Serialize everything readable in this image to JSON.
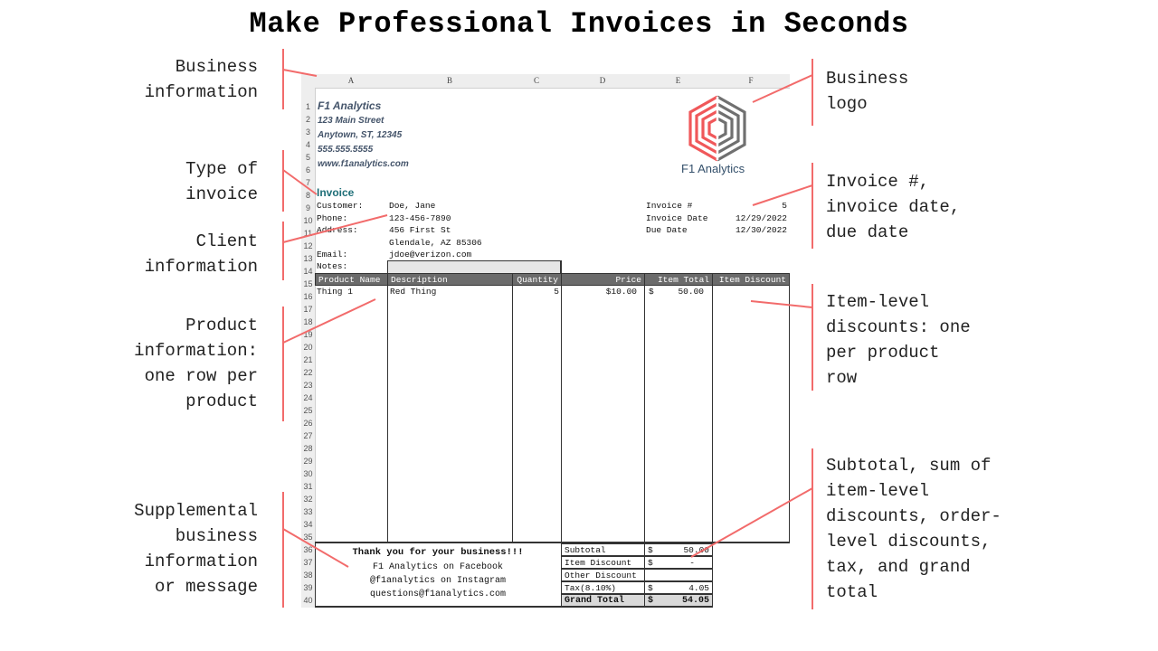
{
  "title": "Make Professional Invoices in Seconds",
  "annotations": {
    "business_info": "Business\ninformation",
    "invoice_type": "Type of\ninvoice",
    "client_info": "Client\ninformation",
    "product_info": "Product\ninformation:\none row per\nproduct",
    "supplemental": "Supplemental\nbusiness\ninformation\nor message",
    "business_logo": "Business\nlogo",
    "invoice_meta": "Invoice #,\ninvoice date,\ndue date",
    "item_discounts": "Item-level\ndiscounts: one\nper product\nrow",
    "totals": "Subtotal, sum of\nitem-level\ndiscounts, order-\nlevel discounts,\ntax, and grand\ntotal"
  },
  "colors": {
    "annotation_line": "#f26b6b",
    "header_fill": "#6b6b6b",
    "business_text": "#44546a",
    "invoice_title": "#1f6f78",
    "logo_red": "#f0585a",
    "logo_gray": "#707070"
  },
  "sheet": {
    "columns": [
      "A",
      "B",
      "C",
      "D",
      "E",
      "F"
    ],
    "row_numbers": [
      "1",
      "2",
      "3",
      "4",
      "5",
      "6",
      "7",
      "8",
      "9",
      "10",
      "11",
      "12",
      "13",
      "14",
      "15",
      "16",
      "17",
      "18",
      "19",
      "20",
      "21",
      "22",
      "23",
      "24",
      "25",
      "26",
      "27",
      "28",
      "29",
      "30",
      "31",
      "32",
      "33",
      "34",
      "35",
      "36",
      "37",
      "38",
      "39",
      "40"
    ],
    "business": {
      "name": "F1 Analytics",
      "street": "123 Main Street",
      "city": "Anytown, ST, 12345",
      "phone": "555.555.5555",
      "website": "www.f1analytics.com"
    },
    "logo": {
      "icon": "hexagon-maze-logo",
      "text": "F1 Analytics"
    },
    "invoice_title": "Invoice",
    "client": {
      "customer_label": "Customer:",
      "customer": "Doe, Jane",
      "phone_label": "Phone:",
      "phone": "123-456-7890",
      "address_label": "Address:",
      "address1": "456 First St",
      "address2": "Glendale, AZ 85306",
      "email_label": "Email:",
      "email": "jdoe@verizon.com",
      "notes_label": "Notes:",
      "notes": ""
    },
    "meta": {
      "invoice_no_label": "Invoice #",
      "invoice_no": "5",
      "invoice_date_label": "Invoice Date",
      "invoice_date": "12/29/2022",
      "due_date_label": "Due Date",
      "due_date": "12/30/2022"
    },
    "table": {
      "headers": [
        "Product Name",
        "Description",
        "Quantity",
        "Price",
        "Item Total",
        "Item Discount"
      ],
      "rows": [
        {
          "product": "Thing 1",
          "description": "Red Thing",
          "quantity": "5",
          "price": "$10.00",
          "total_currency": "$",
          "total": "50.00",
          "discount": ""
        }
      ]
    },
    "footer_message": [
      "Thank you for your business!!!",
      "F1 Analytics on Facebook",
      "@f1analytics on Instagram",
      "questions@f1analytics.com"
    ],
    "totals": [
      {
        "label": "Subtotal",
        "currency": "$",
        "value": "50.00"
      },
      {
        "label": "Item Discount",
        "currency": "$",
        "value": "-"
      },
      {
        "label": "Other Discount",
        "currency": "",
        "value": ""
      },
      {
        "label": "Tax(8.10%)",
        "currency": "$",
        "value": "4.05"
      },
      {
        "label": "Grand Total",
        "currency": "$",
        "value": "54.05"
      }
    ]
  }
}
